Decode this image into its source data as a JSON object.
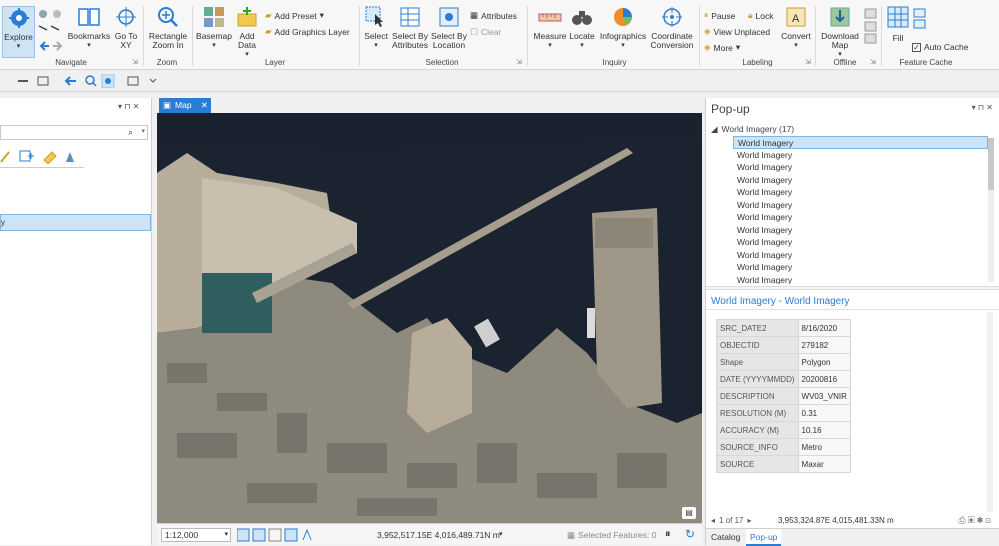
{
  "ribbon": {
    "navigate": {
      "explore": "Explore",
      "bookmarks": "Bookmarks",
      "goto_xy": "Go To XY",
      "group": "Navigate"
    },
    "zoom": {
      "rect_zoom": "Rectangle Zoom In",
      "group": "Zoom"
    },
    "layer": {
      "basemap": "Basemap",
      "add_data": "Add Data",
      "add_preset": "Add Preset",
      "add_graphics_layer": "Add Graphics Layer",
      "group": "Layer"
    },
    "selection": {
      "select": "Select",
      "select_by_attributes": "Select By Attributes",
      "select_by_location": "Select By Location",
      "attributes": "Attributes",
      "clear": "Clear",
      "group": "Selection"
    },
    "inquiry": {
      "measure": "Measure",
      "locate": "Locate",
      "infographics": "Infographics",
      "coord_conversion": "Coordinate Conversion",
      "group": "Inquiry"
    },
    "labeling": {
      "pause": "Pause",
      "lock": "Lock",
      "view_unplaced": "View Unplaced",
      "more": "More",
      "convert": "Convert",
      "group": "Labeling"
    },
    "offline": {
      "download_map": "Download Map",
      "group": "Offline"
    },
    "feature_cache": {
      "fill": "Fill",
      "auto_cache": "Auto Cache",
      "group": "Feature Cache"
    }
  },
  "map_tab": {
    "label": "Map"
  },
  "status": {
    "scale": "1:12,000",
    "coords": "3,952,517.15E 4,016,489.71N m",
    "selected": "Selected Features: 0"
  },
  "popup": {
    "title": "Pop-up",
    "layer": "World Imagery  (17)",
    "items": [
      "World Imagery",
      "World Imagery",
      "World Imagery",
      "World Imagery",
      "World Imagery",
      "World Imagery",
      "World Imagery",
      "World Imagery",
      "World Imagery",
      "World Imagery",
      "World Imagery",
      "World Imagery"
    ],
    "detail_title": "World Imagery - World Imagery",
    "attributes": [
      {
        "k": "SRC_DATE2",
        "v": "8/16/2020"
      },
      {
        "k": "OBJECTID",
        "v": "279182"
      },
      {
        "k": "Shape",
        "v": "Polygon"
      },
      {
        "k": "DATE (YYYYMMDD)",
        "v": "20200816"
      },
      {
        "k": "DESCRIPTION",
        "v": "WV03_VNIR"
      },
      {
        "k": "RESOLUTION (M)",
        "v": "0.31"
      },
      {
        "k": "ACCURACY (M)",
        "v": "10.16"
      },
      {
        "k": "SOURCE_INFO",
        "v": "Metro"
      },
      {
        "k": "SOURCE",
        "v": "Maxar"
      }
    ],
    "pager": "1 of 17",
    "coords": "3,953,324.87E 4,015,481.33N m"
  },
  "bottom_tabs": {
    "catalog": "Catalog",
    "popup": "Pop-up"
  },
  "colors": {
    "accent": "#2b7cd3",
    "selected": "#cce4f7",
    "water": "#1b2330"
  }
}
